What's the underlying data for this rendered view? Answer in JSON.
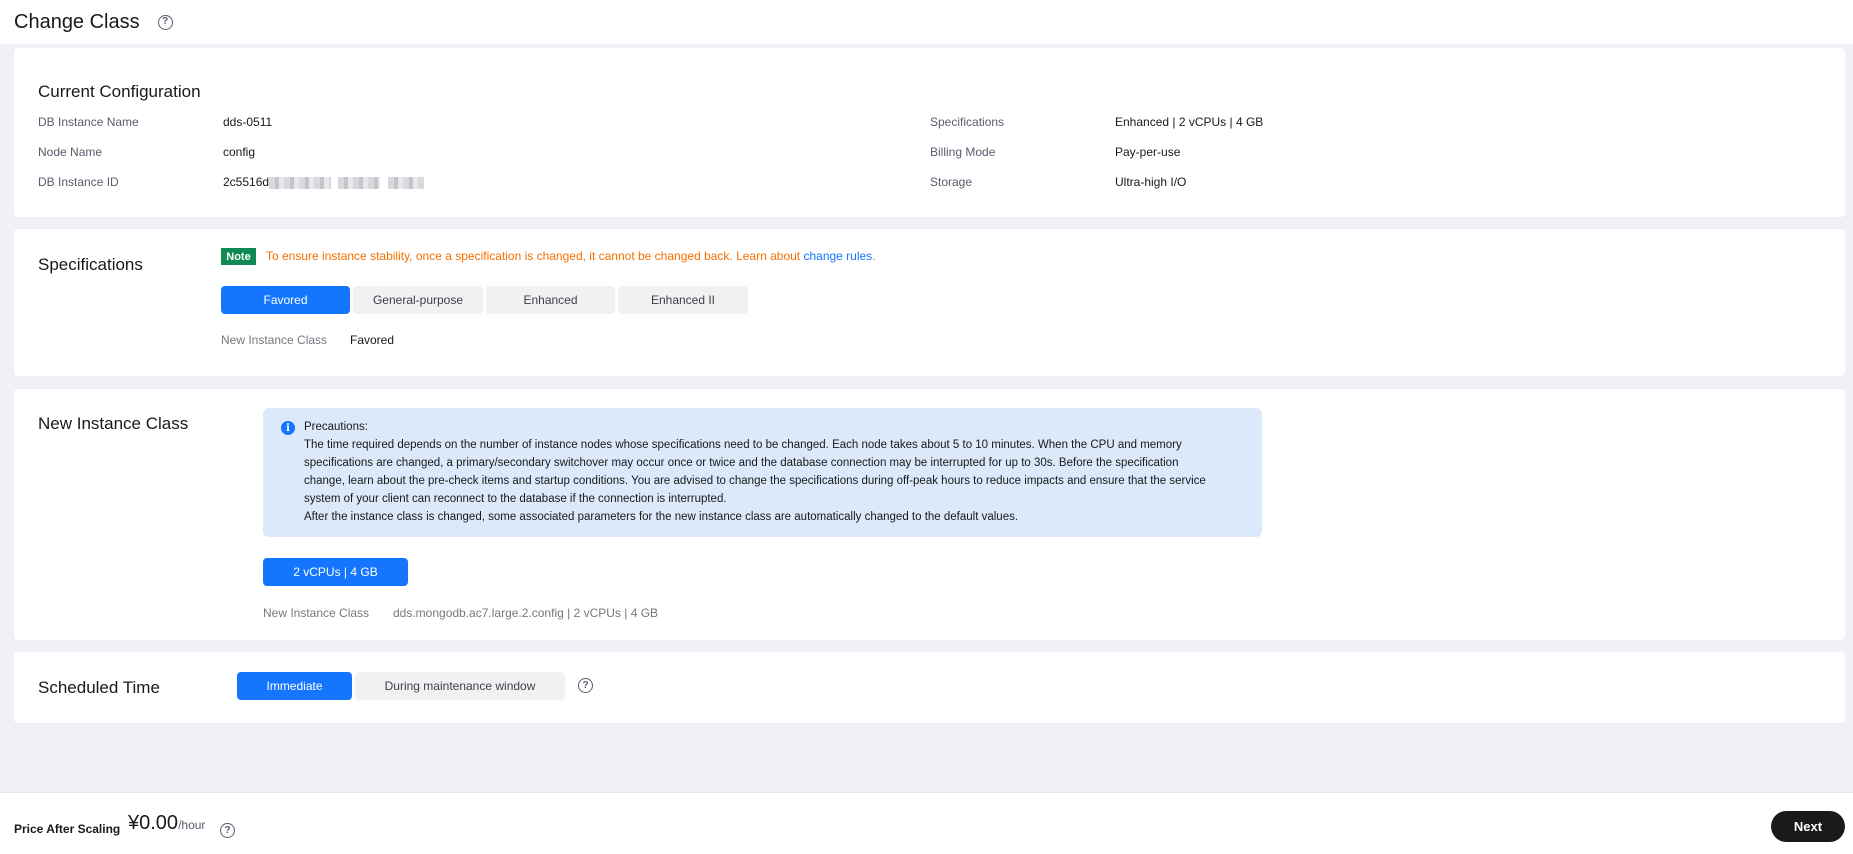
{
  "header": {
    "title": "Change Class",
    "help_icon": "question-circle-icon"
  },
  "current_configuration": {
    "title": "Current Configuration",
    "left": [
      {
        "label": "DB Instance Name",
        "value": "dds-0511"
      },
      {
        "label": "Node Name",
        "value": "config"
      },
      {
        "label": "DB Instance ID",
        "value": "2c5516d"
      }
    ],
    "right": [
      {
        "label": "Specifications",
        "value": "Enhanced | 2 vCPUs | 4 GB"
      },
      {
        "label": "Billing Mode",
        "value": "Pay-per-use"
      },
      {
        "label": "Storage",
        "value": "Ultra-high I/O"
      }
    ]
  },
  "specifications": {
    "title": "Specifications",
    "note_badge": "Note",
    "note_text": "To ensure instance stability, once a specification is changed, it cannot be changed back. Learn about ",
    "note_link": "change rules",
    "note_end": ".",
    "tabs": [
      "Favored",
      "General-purpose",
      "Enhanced",
      "Enhanced II"
    ],
    "active_tab": "Favored",
    "new_class_label": "New Instance Class",
    "new_class_value": "Favored"
  },
  "new_instance_class": {
    "title": "New Instance Class",
    "precautions_title": "Precautions:",
    "precautions_lines": [
      "The time required depends on the number of instance nodes whose specifications need to be changed. Each node takes about 5 to 10 minutes. When the CPU and memory",
      "specifications are changed, a primary/secondary switchover may occur once or twice and the database connection may be interrupted for up to 30s. Before the specification",
      "change, learn about the pre-check items and startup conditions. You are advised to change the specifications during off-peak hours to reduce impacts and ensure that the service",
      "system of your client can reconnect to the database if the connection is interrupted.",
      "After the instance class is changed, some associated parameters for the new instance class are automatically changed to the default values."
    ],
    "option_button": "2 vCPUs | 4 GB",
    "new_class_label": "New Instance Class",
    "new_class_value": "dds.mongodb.ac7.large.2.config | 2 vCPUs | 4 GB"
  },
  "scheduled_time": {
    "title": "Scheduled Time",
    "options": [
      "Immediate",
      "During maintenance window"
    ],
    "active": "Immediate"
  },
  "footer": {
    "price_label": "Price After Scaling",
    "price_value": "¥0.00",
    "price_unit": "/hour",
    "next_label": "Next"
  },
  "colors": {
    "primary": "#1476ff",
    "note_green": "#0e8a52",
    "warning_orange": "#f66f00",
    "alert_bg": "#dbe9fb"
  }
}
